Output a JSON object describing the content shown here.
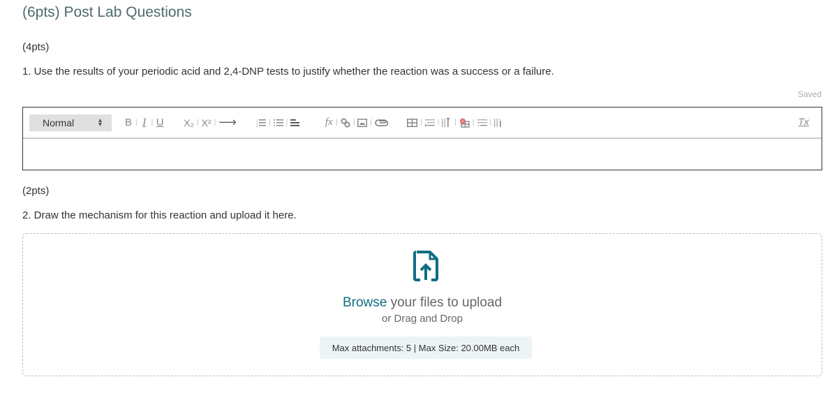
{
  "section": {
    "title": "(6pts) Post Lab Questions"
  },
  "q1": {
    "points": "(4pts)",
    "text": "1. Use the results of your periodic acid and 2,4-DNP tests to justify whether the reaction was a success or a failure.",
    "save_status": "Saved",
    "editor": {
      "format_value": "Normal",
      "toolbar": {
        "bold": "B",
        "italic": "I",
        "underline": "U",
        "subscript": "X₂",
        "superscript": "X²",
        "indent": "⟶",
        "formula": "fx",
        "clear_format": "Tx"
      },
      "content": ""
    }
  },
  "q2": {
    "points": "(2pts)",
    "text": "2. Draw the mechanism for this reaction and upload it here.",
    "upload": {
      "browse_label": "Browse",
      "browse_suffix": " your files to upload",
      "drag_drop": "or Drag and Drop",
      "limits": "Max attachments: 5 | Max Size: 20.00MB each",
      "accent_color": "#0f6e7f"
    }
  }
}
